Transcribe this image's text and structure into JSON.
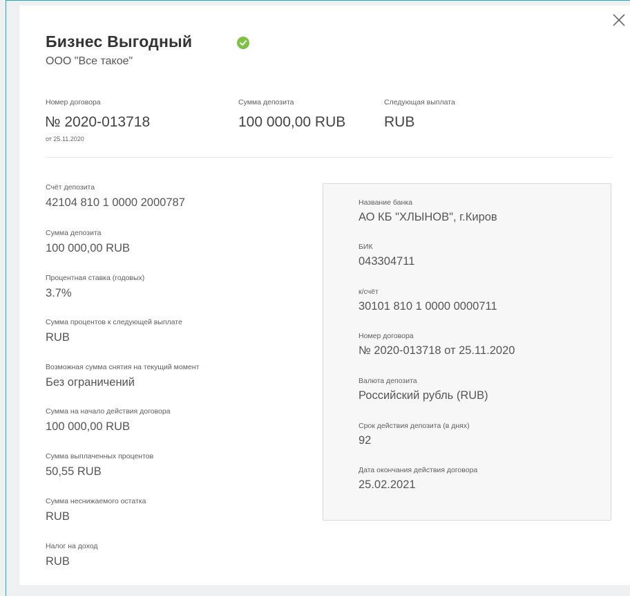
{
  "header": {
    "title": "Бизнес Выгодный",
    "company": "ООО \"Все такое\"",
    "close_icon": "close-icon",
    "status_icon": "check-circle-icon",
    "status_color": "#7dc242"
  },
  "summary": {
    "contract_label": "Номер договора",
    "contract_value": "№ 2020-013718",
    "contract_date": "от 25.11.2020",
    "deposit_label": "Сумма депозита",
    "deposit_value": "100 000,00 RUB",
    "next_payment_label": "Следующая выплата",
    "next_payment_value": "RUB"
  },
  "details": [
    {
      "label": "Счёт депозита",
      "value": "42104 810 1 0000 2000787"
    },
    {
      "label": "Сумма депозита",
      "value": "100 000,00 RUB"
    },
    {
      "label": "Процентная ставка (годовых)",
      "value": "3.7%"
    },
    {
      "label": "Сумма процентов к следующей выплате",
      "value": "RUB"
    },
    {
      "label": "Возможная сумма снятия на текущий момент",
      "value": "Без ограничений"
    },
    {
      "label": "Сумма на начало действия договора",
      "value": "100 000,00 RUB"
    },
    {
      "label": "Сумма выплаченных процентов",
      "value": "50,55 RUB"
    },
    {
      "label": "Сумма неснижаемого остатка",
      "value": "RUB"
    },
    {
      "label": "Налог на доход",
      "value": "RUB"
    }
  ],
  "bank": [
    {
      "label": "Название банка",
      "value": "АО КБ \"ХЛЫНОВ\", г.Киров"
    },
    {
      "label": "БИК",
      "value": "043304711"
    },
    {
      "label": "к/счёт",
      "value": "30101 810 1 0000 0000711"
    },
    {
      "label": "Номер договора",
      "value": "№ 2020-013718 от 25.11.2020"
    },
    {
      "label": "Валюта депозита",
      "value": "Российский рубль (RUB)"
    },
    {
      "label": "Срок действия депозита (в днях)",
      "value": "92"
    },
    {
      "label": "Дата окончания действия договора",
      "value": "25.02.2021"
    }
  ]
}
